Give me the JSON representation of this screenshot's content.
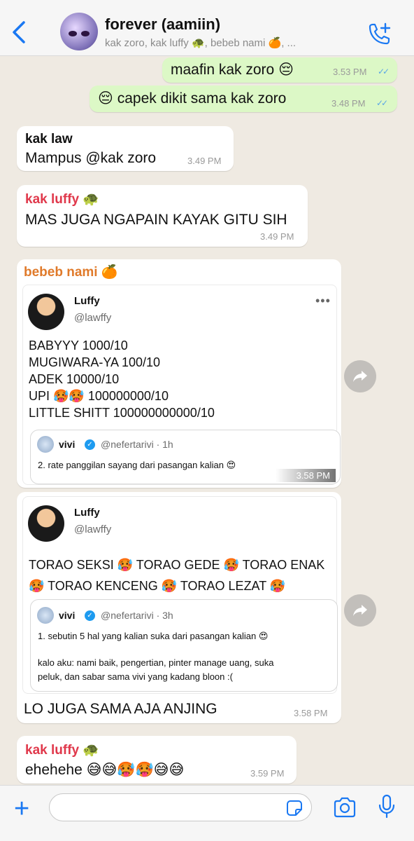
{
  "header": {
    "title": "forever (aamiin)",
    "subtitle": "kak zoro, kak luffy 🐢, bebeb nami 🍊, ..."
  },
  "messages": [
    {
      "text": "maafin kak zoro 😔",
      "time": "3.53 PM"
    },
    {
      "text": "😔 capek dikit sama kak zoro",
      "time": "3.48 PM"
    },
    {
      "sender": "kak law",
      "text": "Mampus @kak zoro",
      "time": "3.49 PM"
    },
    {
      "sender": "kak luffy 🐢",
      "text": "MAS JUGA NGAPAIN KAYAK GITU SIH",
      "time": "3.49 PM"
    },
    {
      "sender": "bebeb nami 🍊",
      "time": "3.58 PM"
    },
    {
      "text": "LO JUGA SAMA AJA ANJING",
      "time": "3.58 PM"
    },
    {
      "sender": "kak luffy 🐢",
      "text": "ehehehe 😅😅🥵🥵😅😅",
      "time": "3.59 PM"
    }
  ],
  "tweet1": {
    "name": "Luffy",
    "handle": "@lawffy",
    "lines": [
      "BABYYY 1000/10",
      "MUGIWARA-YA 100/10",
      "ADEK 10000/10",
      "UPI 🥵🥵  100000000/10",
      "LITTLE SHITT 100000000000/10"
    ],
    "quote": {
      "name": "vivi",
      "handle": "@nefertarivi · 1h",
      "text": "2. rate panggilan sayang dari pasangan kalian 😍"
    }
  },
  "tweet2": {
    "name": "Luffy",
    "handle": "@lawffy",
    "lines": [
      "TORAO SEKSI 🥵  TORAO GEDE 🥵  TORAO ENAK",
      "🥵  TORAO KENCENG 🥵  TORAO LEZAT 🥵"
    ],
    "quote": {
      "name": "vivi",
      "handle": "@nefertarivi · 3h",
      "line1": "1. sebutin 5 hal yang kalian suka dari pasangan kalian 😍",
      "line2": "kalo aku: nami baik, pengertian, pinter manage uang, suka",
      "line3": "peluk, dan sabar sama vivi yang kadang bloon :("
    }
  },
  "colors": {
    "outgoing_bubble": "#dcf8c6",
    "incoming_bubble": "#ffffff",
    "accent": "#1a78f2",
    "sender_red": "#e0384b",
    "sender_orange": "#e07a2a"
  }
}
